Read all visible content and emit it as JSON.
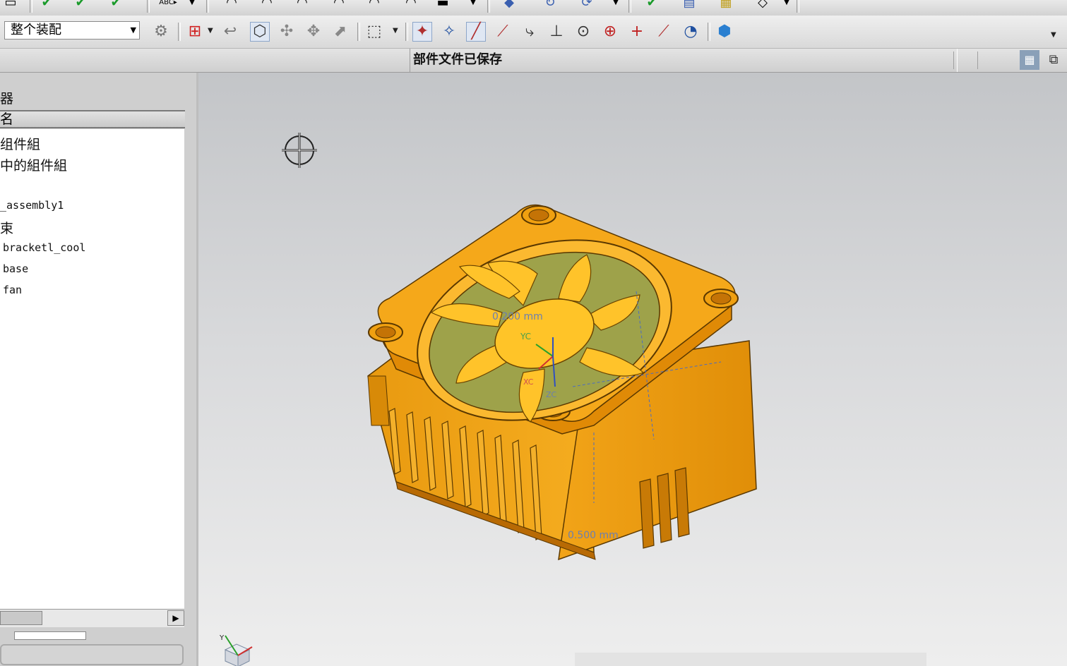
{
  "toolbar_top": {
    "icons": [
      "check-icon",
      "check-icon",
      "check-icon",
      "abc-text-icon",
      "view-icon",
      "render-icon",
      "layer-icon",
      "sync-icon",
      "edit-icon",
      "layout-icon",
      "measure-icon",
      "box-view-icon"
    ]
  },
  "toolbar": {
    "scope_select_value": "整个装配"
  },
  "status": {
    "message": "部件文件已保存"
  },
  "navigator": {
    "title": "器",
    "column_header": "名",
    "items": [
      {
        "label": "组件組",
        "style": "cjk"
      },
      {
        "label": "中的組件組",
        "style": "cjk"
      },
      {
        "label": "_assembly1",
        "style": "mono"
      },
      {
        "label": "束",
        "style": "cjk"
      },
      {
        "label": "bracketl_cool",
        "style": "mono"
      },
      {
        "label": "base",
        "style": "mono"
      },
      {
        "label": "fan",
        "style": "mono"
      }
    ]
  },
  "viewport": {
    "dimension_top": "0.200 mm",
    "dimension_bottom": "0.500 mm",
    "axis_label_yc": "YC",
    "axis_label_xc": "XC",
    "axis_label_zc": "ZC",
    "triad_label_y": "Y"
  },
  "colors": {
    "model_orange": "#f0a010",
    "model_dark": "#c07008",
    "fan_blade": "#ffc32a",
    "viewport_top": "#c3c5c8",
    "viewport_bottom": "#eeeeee"
  }
}
